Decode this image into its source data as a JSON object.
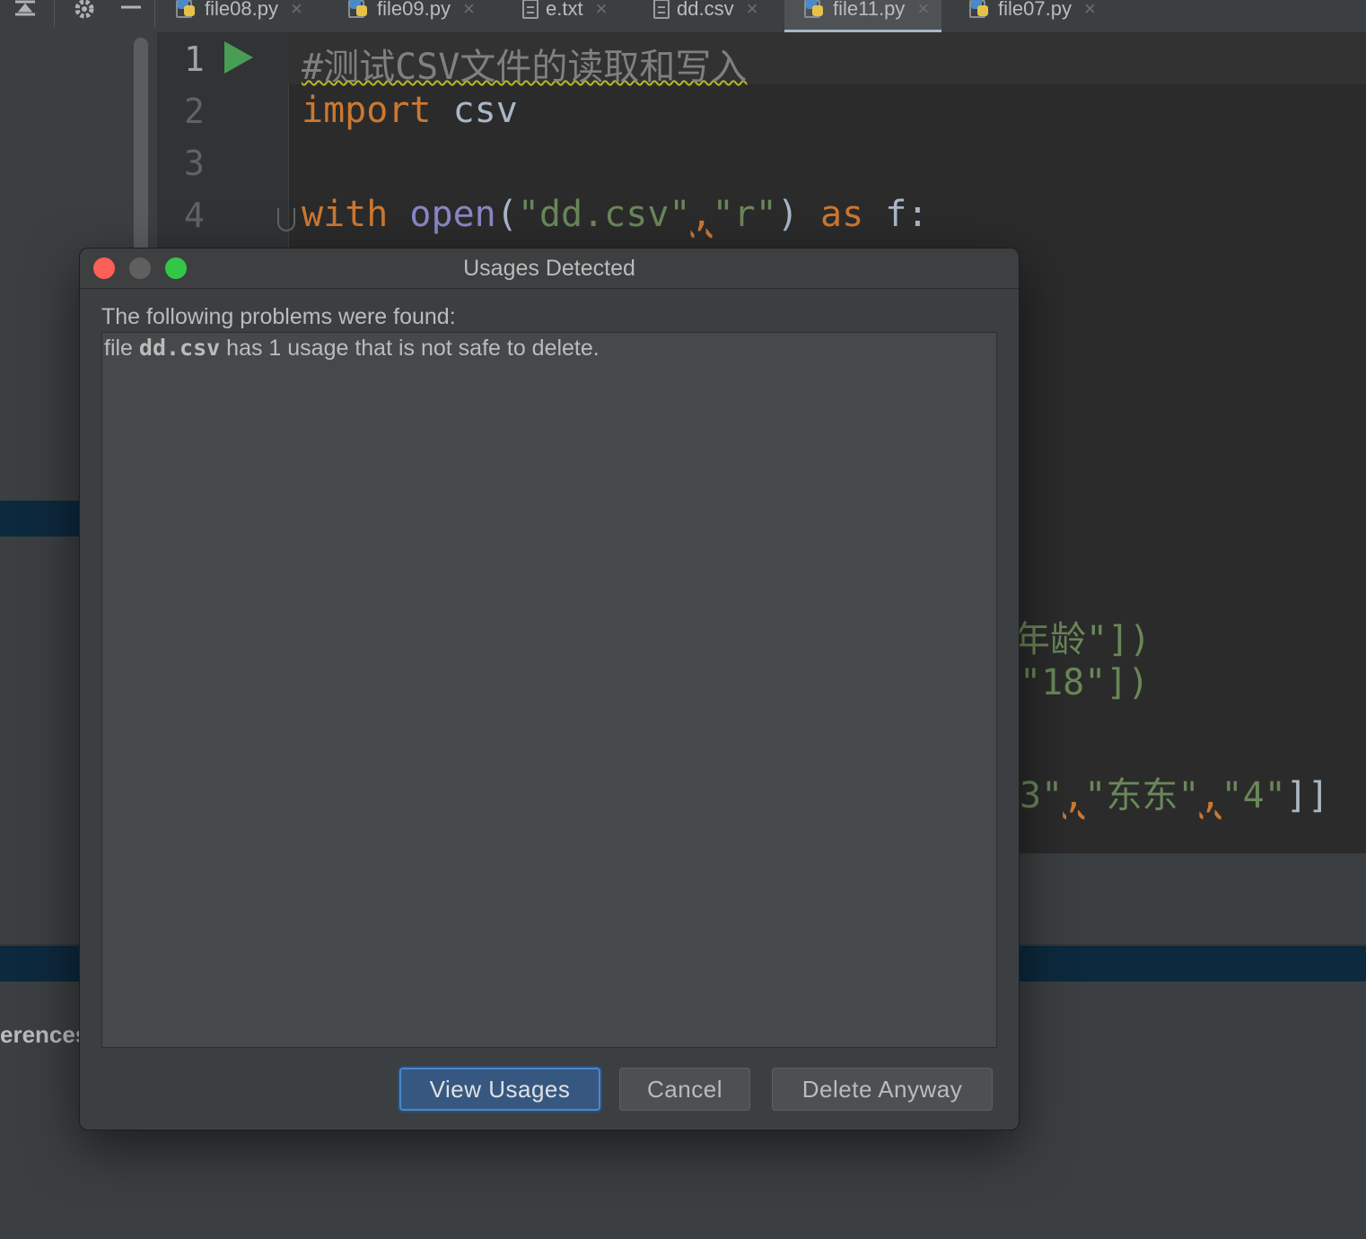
{
  "toolbar": {
    "icons": [
      "collapse-icon",
      "gear-icon",
      "minimize-icon"
    ],
    "tabs": [
      {
        "label": "file08.py",
        "icon": "python-file-icon",
        "active": false
      },
      {
        "label": "file09.py",
        "icon": "python-file-icon",
        "active": false
      },
      {
        "label": "e.txt",
        "icon": "text-file-icon",
        "active": false
      },
      {
        "label": "dd.csv",
        "icon": "text-file-icon",
        "active": false
      },
      {
        "label": "file11.py",
        "icon": "python-file-icon",
        "active": true
      },
      {
        "label": "file07.py",
        "icon": "python-file-icon",
        "active": false
      }
    ],
    "close_glyph": "×"
  },
  "editor": {
    "line_numbers": [
      "1",
      "2",
      "3",
      "4"
    ],
    "line1_comment": "#测试CSV文件的读取和写入",
    "line2": {
      "kw": "import",
      "rest": " csv"
    },
    "line4": {
      "kw_with": "with",
      "fn_open": "open",
      "p_open": "(",
      "str_file": "\"dd.csv\"",
      "comma": ",",
      "str_mode": "\"r\"",
      "p_close": ")",
      "kw_as": "as",
      "rest": " f:"
    },
    "partial_lines": {
      "row_a": "年龄\"])",
      "row_b": "\"18\"])",
      "row_c_a": "3\"",
      "row_c_comma1": ",",
      "row_c_b": "\"东东\"",
      "row_c_comma2": ",",
      "row_c_c": "\"4\"",
      "row_c_end": "]]"
    },
    "colors": {
      "keyword": "#cc7832",
      "builtin": "#8888c6",
      "string": "#6a8759",
      "comment": "#808080"
    }
  },
  "bottom_panel": {
    "label": "erences"
  },
  "dialog": {
    "title": "Usages Detected",
    "header": "The following problems were found:",
    "problem": {
      "prefix": "file ",
      "filename": "dd.csv",
      "suffix": " has 1 usage that is not safe to delete."
    },
    "buttons": {
      "view_usages": "View Usages",
      "cancel": "Cancel",
      "delete_anyway": "Delete Anyway"
    },
    "colors": {
      "close": "#fc5f57",
      "minimize": "#5f5f5f",
      "maximize": "#33c748",
      "default_button": "#365880"
    }
  }
}
